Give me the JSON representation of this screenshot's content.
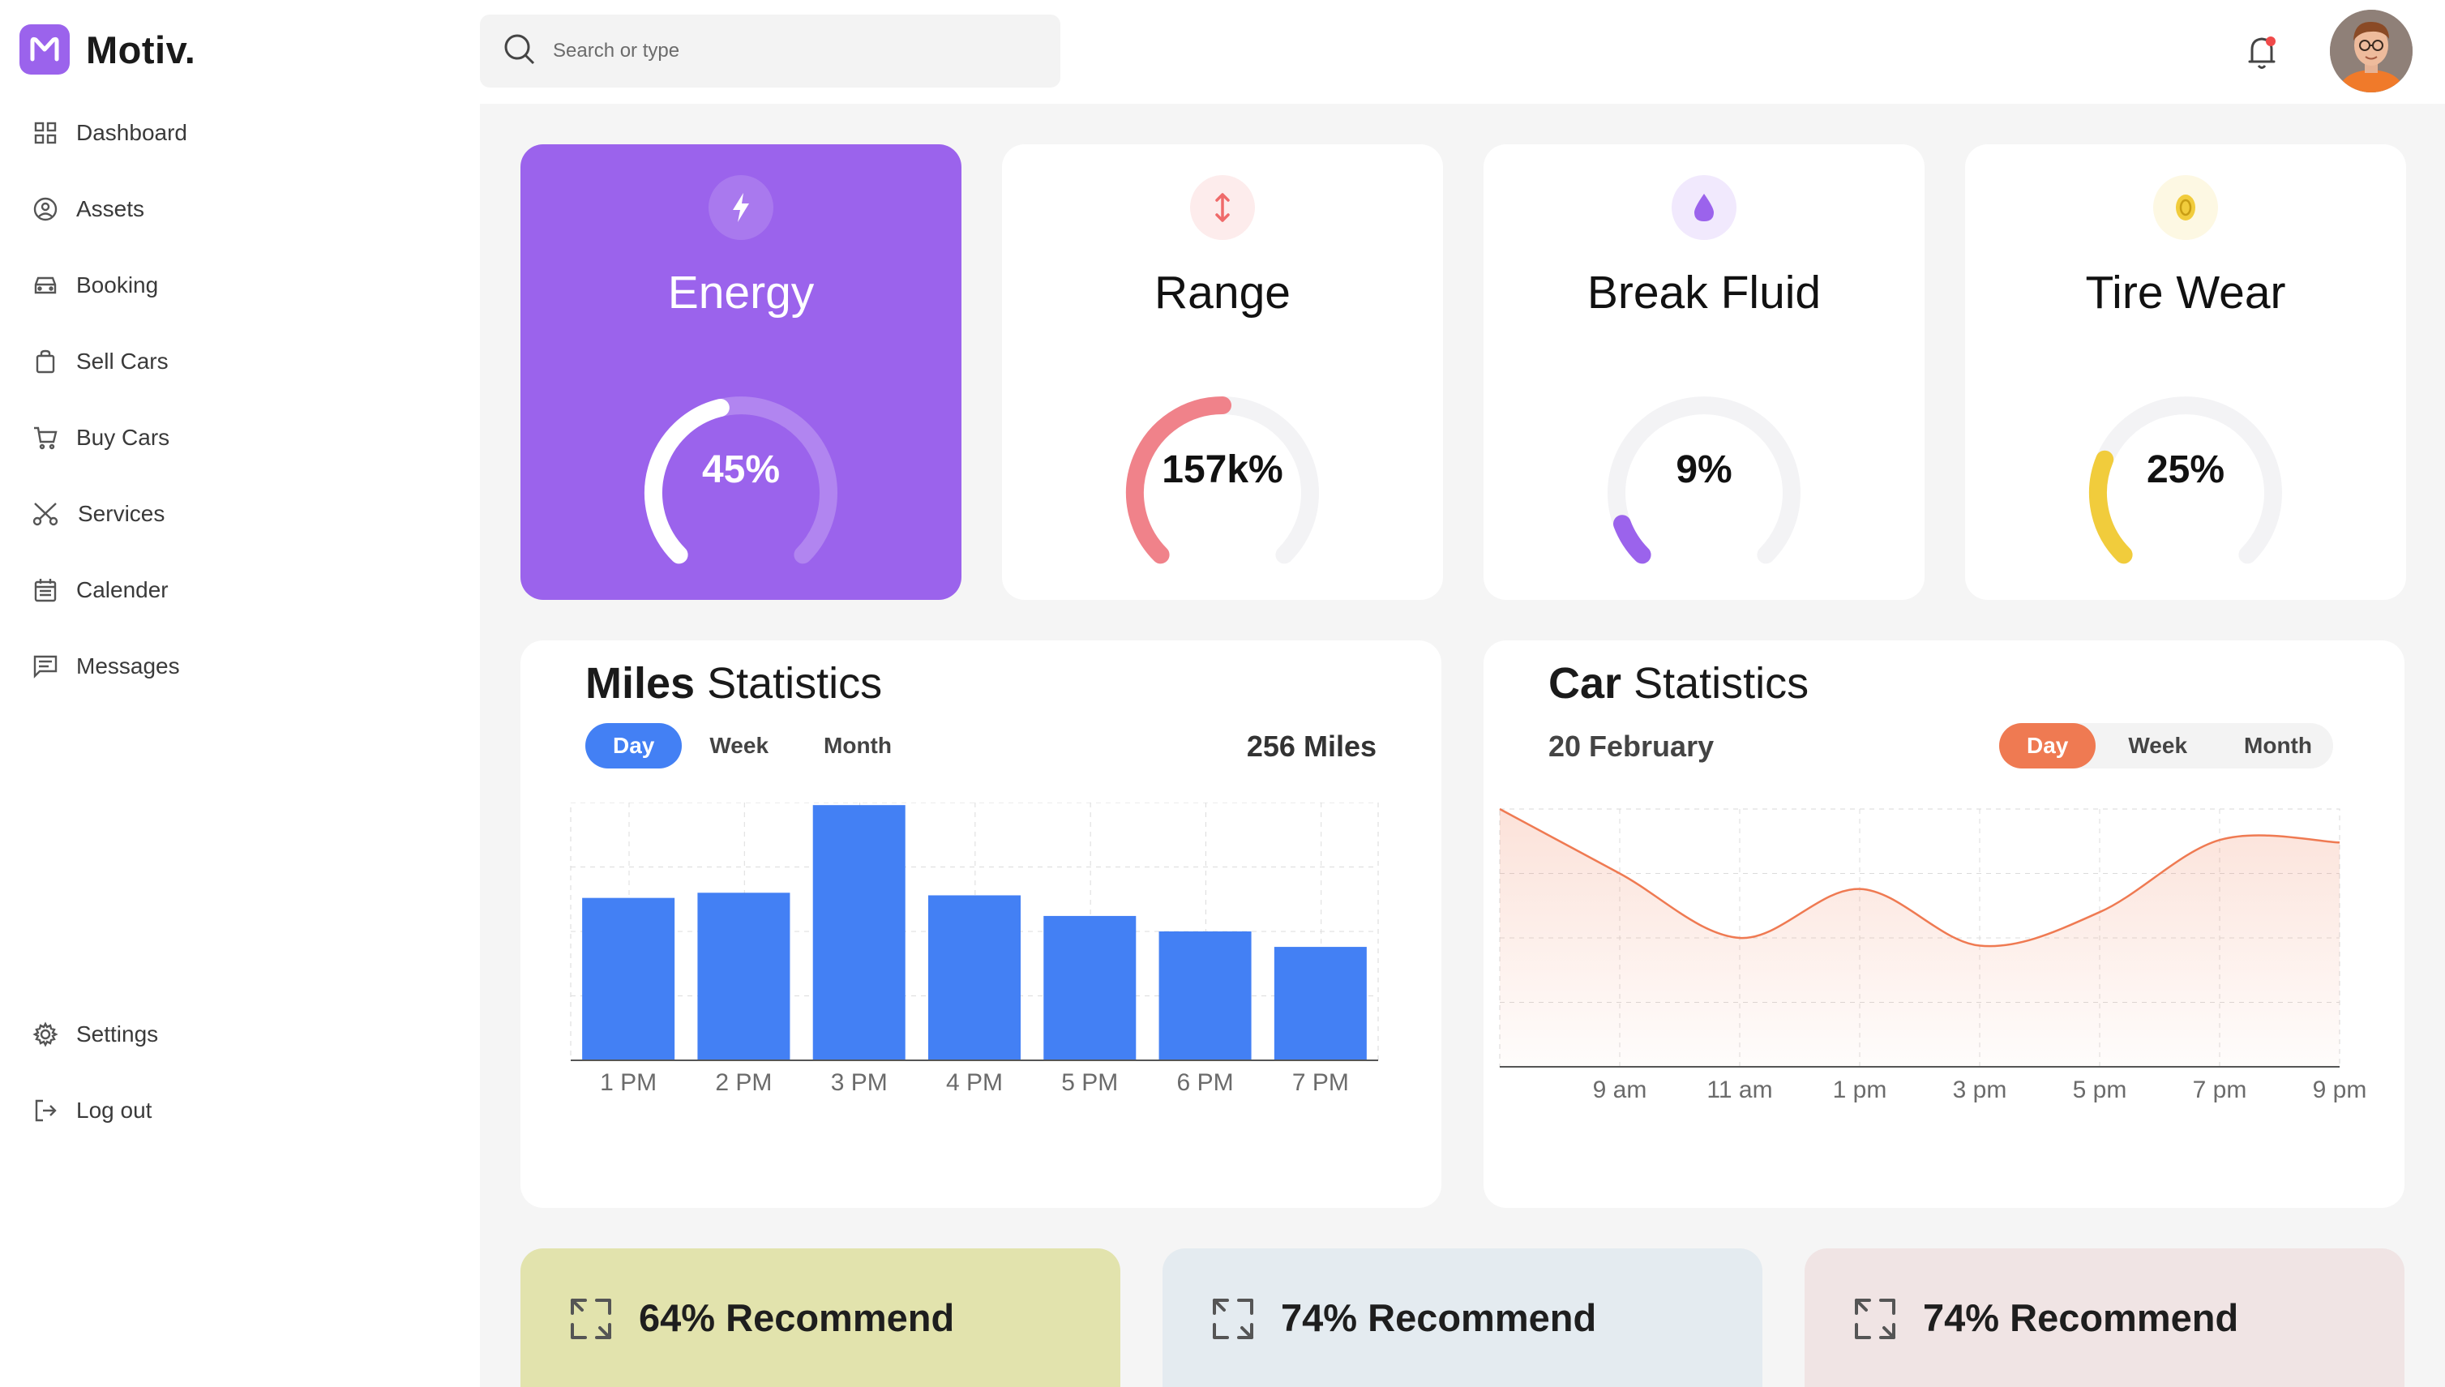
{
  "app": {
    "name": "Motiv."
  },
  "search": {
    "placeholder": "Search or type"
  },
  "sidebar": {
    "items": [
      {
        "label": "Dashboard",
        "icon": "grid-icon"
      },
      {
        "label": "Assets",
        "icon": "steering-wheel-icon"
      },
      {
        "label": "Booking",
        "icon": "car-icon"
      },
      {
        "label": "Sell Cars",
        "icon": "shopping-bag-icon"
      },
      {
        "label": "Buy Cars",
        "icon": "cart-icon"
      },
      {
        "label": "Services",
        "icon": "scissors-icon"
      },
      {
        "label": "Calender",
        "icon": "calendar-icon"
      },
      {
        "label": "Messages",
        "icon": "message-icon"
      }
    ],
    "bottom": [
      {
        "label": "Settings",
        "icon": "gear-icon"
      },
      {
        "label": "Log out",
        "icon": "logout-icon"
      }
    ]
  },
  "gauges": [
    {
      "title": "Energy",
      "value": "45%",
      "level": 0.45,
      "color": "#ffffff",
      "icon": "lightning-icon"
    },
    {
      "title": "Range",
      "value": "157k%",
      "level": 0.5,
      "color": "#f0828a",
      "icon": "up-down-arrow-icon"
    },
    {
      "title": "Break Fluid",
      "value": "9%",
      "level": 0.09,
      "color": "#9b63ec",
      "icon": "drop-icon"
    },
    {
      "title": "Tire Wear",
      "value": "25%",
      "level": 0.25,
      "color": "#f1cc3c",
      "icon": "coin-icon"
    }
  ],
  "miles": {
    "title_bold": "Miles",
    "title_rest": "Statistics",
    "tabs": [
      "Day",
      "Week",
      "Month"
    ],
    "active_tab": "Day",
    "total": "256 Miles"
  },
  "car": {
    "title_bold": "Car",
    "title_rest": "Statistics",
    "date": "20 February",
    "tabs": [
      "Day",
      "Week",
      "Month"
    ],
    "active_tab": "Day"
  },
  "recommend": [
    {
      "label": "64% Recommend",
      "bg": "#e2e3ad"
    },
    {
      "label": "74% Recommend",
      "bg": "#e4ebf0"
    },
    {
      "label": "74% Recommend",
      "bg": "#f0e4e4"
    }
  ],
  "chart_data": [
    {
      "type": "bar",
      "categories": [
        "1 PM",
        "2 PM",
        "3 PM",
        "4 PM",
        "5 PM",
        "6 PM",
        "7 PM"
      ],
      "values": [
        63,
        65,
        99,
        64,
        56,
        50,
        44
      ],
      "ylim": [
        0,
        100
      ],
      "grid": true,
      "color": "#4380f4"
    },
    {
      "type": "area",
      "x": [
        "9 am",
        "11 am",
        "1 pm",
        "3 pm",
        "5 pm",
        "7 pm",
        "9 pm"
      ],
      "points": [
        [
          0,
          100
        ],
        [
          1,
          75
        ],
        [
          2,
          50
        ],
        [
          3,
          69
        ],
        [
          4,
          47
        ],
        [
          5,
          60
        ],
        [
          6,
          88
        ],
        [
          7,
          87
        ]
      ],
      "xlim": [
        0,
        7
      ],
      "ylim": [
        0,
        100
      ],
      "grid": true,
      "color": "#ef7a52"
    }
  ]
}
